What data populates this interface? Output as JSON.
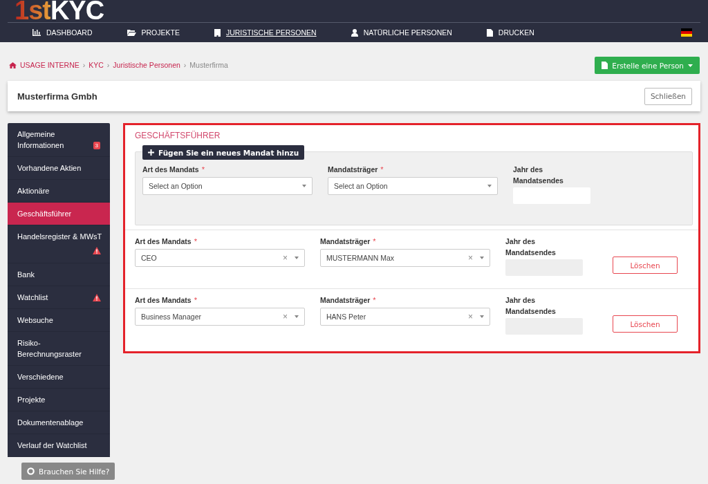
{
  "logo": {
    "part_1": "1st",
    "part_2": "KYC"
  },
  "nav": [
    {
      "label": "DASHBOARD",
      "kind": "chart",
      "selected": false
    },
    {
      "label": "PROJEKTE",
      "kind": "folder",
      "selected": false
    },
    {
      "label": "JURISTISCHE PERSONEN",
      "kind": "building",
      "selected": true
    },
    {
      "label": "NATÜRLICHE PERSONEN",
      "kind": "user",
      "selected": false
    },
    {
      "label": "DRUCKEN",
      "kind": "file",
      "selected": false
    }
  ],
  "breadcrumb": [
    {
      "label": "USAGE INTERNE",
      "kind": "link"
    },
    {
      "label": "KYC",
      "kind": "link"
    },
    {
      "label": "Juristische Personen",
      "kind": "link"
    },
    {
      "label": "Musterfirma",
      "kind": "current"
    }
  ],
  "breadcrumb_separator": "›",
  "create_button": "Erstelle eine Person",
  "title": "Musterfirma Gmbh",
  "close_button": "Schließen",
  "sidebar": [
    {
      "label": "Allgemeine Informationen",
      "selected": false,
      "badge": "3"
    },
    {
      "label": "Vorhandene Aktien",
      "selected": false
    },
    {
      "label": "Aktionäre",
      "selected": false
    },
    {
      "label": "Geschäftsführer",
      "selected": true
    },
    {
      "label": "Handelsregister & MWsT",
      "selected": false,
      "warning": true
    },
    {
      "label": "Bank",
      "selected": false
    },
    {
      "label": "Watchlist",
      "selected": false,
      "warning": true
    },
    {
      "label": "Websuche",
      "selected": false
    },
    {
      "label": "Risiko-Berechnungsraster",
      "selected": false
    },
    {
      "label": "Verschiedene",
      "selected": false
    },
    {
      "label": "Projekte",
      "selected": false
    },
    {
      "label": "Dokumentenablage",
      "selected": false
    },
    {
      "label": "Verlauf der Watchlist",
      "selected": false
    }
  ],
  "help_button": "Brauchen Sie Hilfe?",
  "section_title": "GESCHÄFTSFÜHRER",
  "new_mandate": {
    "button": "Fügen Sie ein neues Mandat hinzu",
    "type_label": "Art des Mandats",
    "type_placeholder": "Select an Option",
    "holder_label": "Mandatsträger",
    "holder_placeholder": "Select an Option",
    "year_label": "Jahr des Mandatsendes"
  },
  "required_mark": "*",
  "mandates": [
    {
      "type_label": "Art des Mandats",
      "type": "CEO",
      "holder_label": "Mandatsträger",
      "holder": "MUSTERMANN Max",
      "year_label": "Jahr des Mandatsendes",
      "delete": "Löschen"
    },
    {
      "type_label": "Art des Mandats",
      "type": "Business Manager",
      "holder_label": "Mandatsträger",
      "holder": "HANS Peter",
      "year_label": "Jahr des Mandatsendes",
      "delete": "Löschen"
    }
  ],
  "clear_mark": "×"
}
